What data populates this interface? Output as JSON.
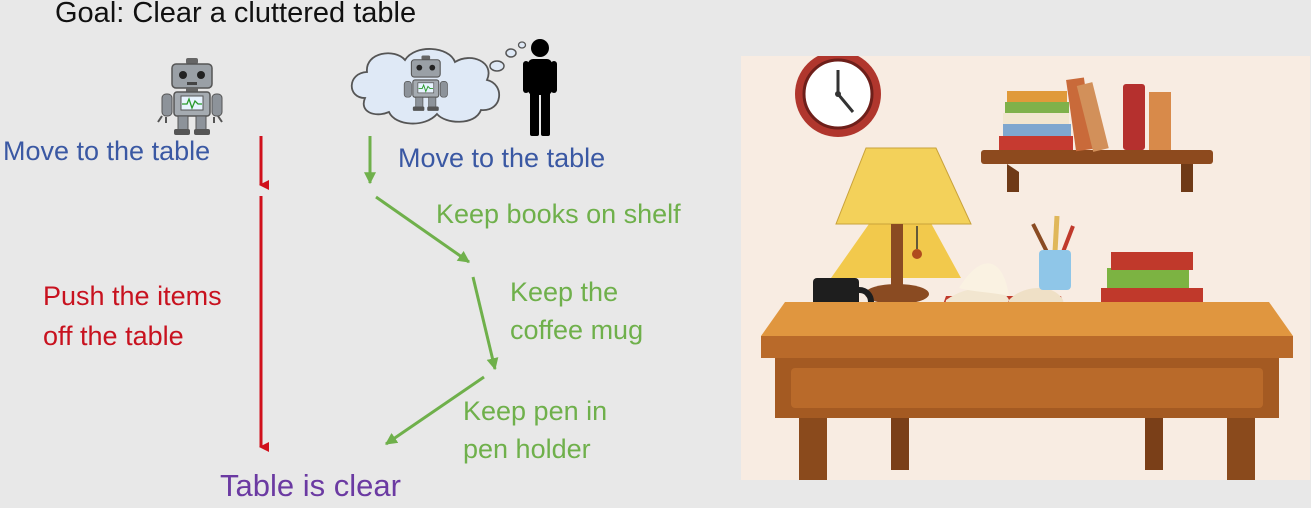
{
  "goal": "Goal: Clear a cluttered table",
  "left_path": {
    "step1": "Move to the table",
    "step2": "Push the items\noff the table"
  },
  "right_path": {
    "step1": "Move to the table",
    "step2": "Keep books on shelf",
    "step3": "Keep the\ncoffee mug",
    "step4": "Keep pen in\npen holder"
  },
  "result": "Table is clear",
  "icons": {
    "robot": "robot-icon",
    "thought": "thought-bubble-icon",
    "human": "human-silhouette-icon",
    "scene": "desk-scene-illustration"
  },
  "colors": {
    "naive_path": "#d0101c",
    "aware_path": "#6fb04b",
    "start_label": "#3a58a3",
    "result_label": "#6b3aa2"
  }
}
